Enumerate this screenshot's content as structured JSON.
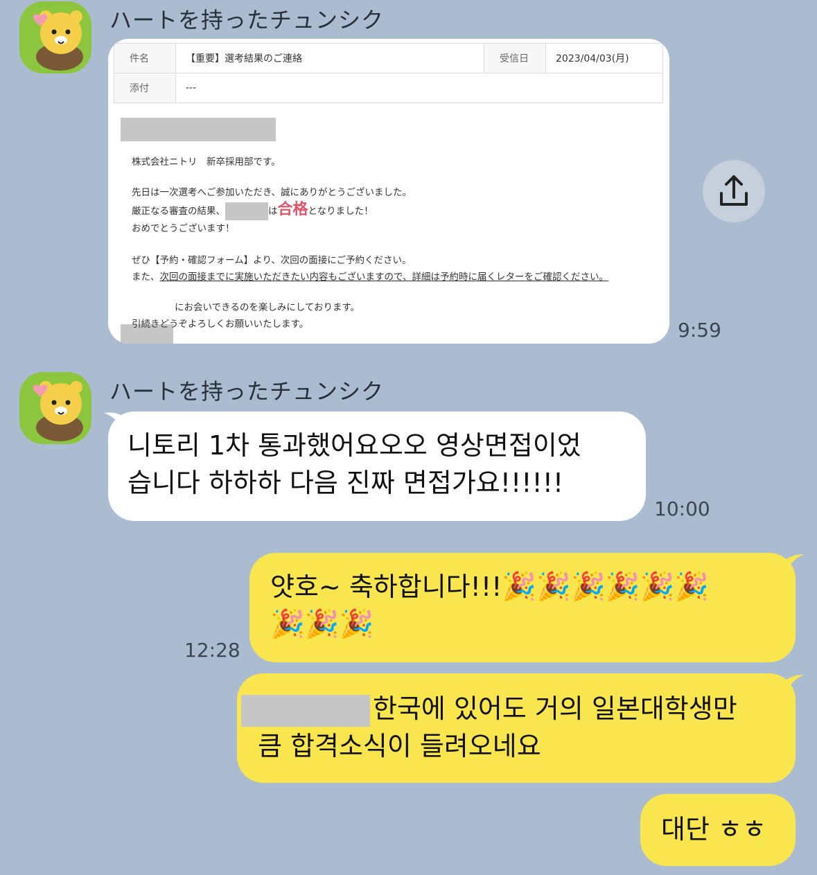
{
  "chat": {
    "sender_name": "ハートを持ったチュンシク",
    "messages": [
      {
        "time": "9:59"
      },
      {
        "text_line1": "니토리 1차 통과했어요오오 영상면접이었",
        "text_line2": "습니다 하하하 다음 진짜 면접가요!!!!!!",
        "time": "10:00"
      },
      {
        "text_line1": "얏호~ 축하합니다!!!",
        "party_row1": "🎉🎉🎉🎉🎉🎉",
        "party_row2": "🎉🎉🎉",
        "time": "12:28"
      },
      {
        "text_line1": "한국에 있어도 거의 일본대학생만",
        "text_line2": "큼 합격소식이 들려오네요"
      },
      {
        "text": "대단 ㅎㅎ"
      }
    ]
  },
  "email": {
    "subject_label": "件名",
    "subject": "【重要】選考結果のご連絡",
    "received_label": "受信日",
    "received_date": "2023/04/03(月)",
    "attachment_label": "添付",
    "attachment_value": "---",
    "line_company": "株式会社ニトリ　新卒採用部です。",
    "line_thanks": "先日は一次選考へご参加いただき、誠にありがとうございました。",
    "line_result_pre": "厳正なる審査の結果、",
    "line_result_ha": "は",
    "line_result_pass": "合格",
    "line_result_post": "となりました！",
    "line_congrats": "おめでとうございます！",
    "line_form": "ぜひ【予約・確認フォーム】より、次回の面接にご予約ください。",
    "line_also_pre": "また、",
    "line_also_ul": "次回の面接までに実施いただきたい内容もございますので、詳細は予約時に届くレターをご確認ください。",
    "line_meet": "にお会いできるのを楽しみにしております。",
    "line_regards": "引続きどうぞよろしくお願いいたします。"
  },
  "icons": {
    "share": "share-upload-icon",
    "avatar": "bear-holding-heart-avatar"
  },
  "colors": {
    "background": "#abbcd1",
    "incoming_bubble": "#ffffff",
    "outgoing_bubble": "#f9e64f",
    "avatar_bg": "#8cc63e",
    "pass_text": "#e0566a"
  }
}
